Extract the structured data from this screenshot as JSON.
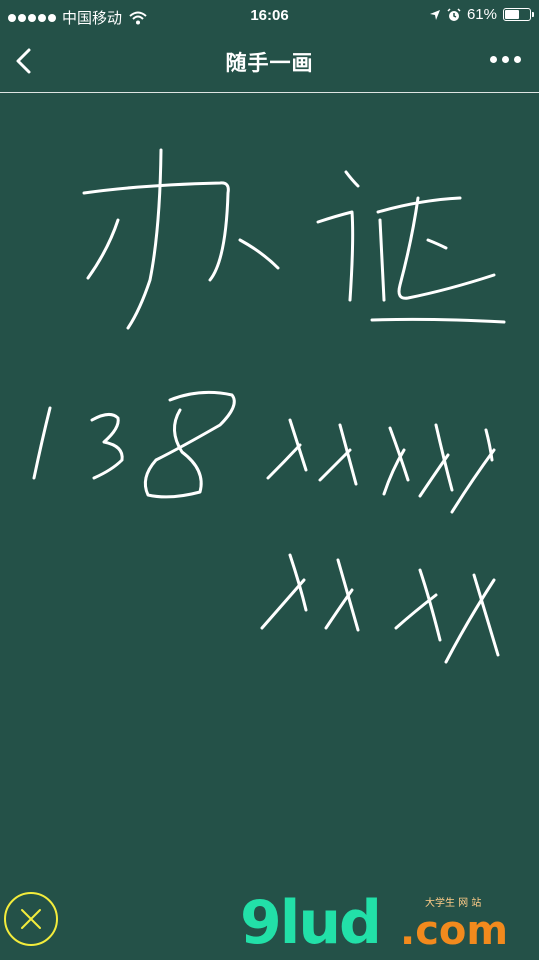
{
  "status_bar": {
    "carrier": "中国移动",
    "time": "16:06",
    "battery": "61%",
    "battery_level": 0.61
  },
  "nav": {
    "title": "随手一画",
    "back_icon": "chevron-left-icon",
    "more_icon": "more-dots-icon"
  },
  "canvas": {
    "background": "#245148",
    "ink_color": "#ffffff"
  },
  "close_button": {
    "icon": "close-icon",
    "border_color": "#f3ec3c"
  },
  "watermark": {
    "main": "9lud",
    "sub": ".com",
    "tagline": "大学生 网 站"
  }
}
